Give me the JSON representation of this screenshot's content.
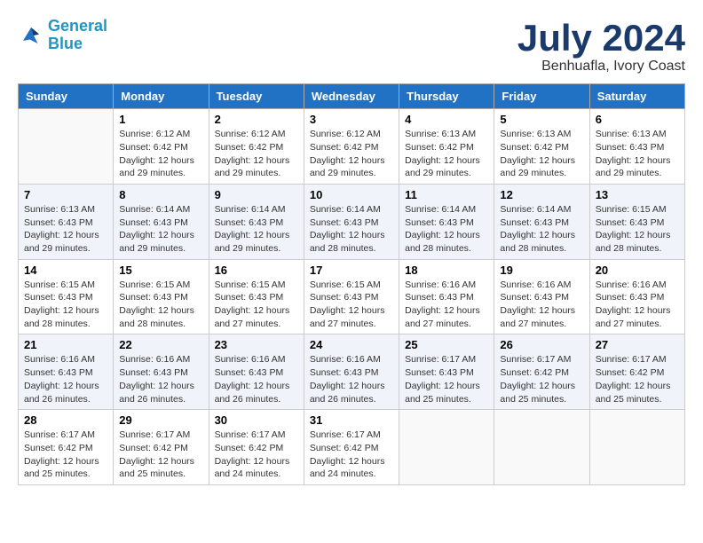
{
  "header": {
    "logo_line1": "General",
    "logo_line2": "Blue",
    "month_year": "July 2024",
    "location": "Benhuafla, Ivory Coast"
  },
  "weekdays": [
    "Sunday",
    "Monday",
    "Tuesday",
    "Wednesday",
    "Thursday",
    "Friday",
    "Saturday"
  ],
  "rows": [
    [
      {
        "day": "",
        "info": ""
      },
      {
        "day": "1",
        "info": "Sunrise: 6:12 AM\nSunset: 6:42 PM\nDaylight: 12 hours\nand 29 minutes."
      },
      {
        "day": "2",
        "info": "Sunrise: 6:12 AM\nSunset: 6:42 PM\nDaylight: 12 hours\nand 29 minutes."
      },
      {
        "day": "3",
        "info": "Sunrise: 6:12 AM\nSunset: 6:42 PM\nDaylight: 12 hours\nand 29 minutes."
      },
      {
        "day": "4",
        "info": "Sunrise: 6:13 AM\nSunset: 6:42 PM\nDaylight: 12 hours\nand 29 minutes."
      },
      {
        "day": "5",
        "info": "Sunrise: 6:13 AM\nSunset: 6:42 PM\nDaylight: 12 hours\nand 29 minutes."
      },
      {
        "day": "6",
        "info": "Sunrise: 6:13 AM\nSunset: 6:43 PM\nDaylight: 12 hours\nand 29 minutes."
      }
    ],
    [
      {
        "day": "7",
        "info": "Sunrise: 6:13 AM\nSunset: 6:43 PM\nDaylight: 12 hours\nand 29 minutes."
      },
      {
        "day": "8",
        "info": "Sunrise: 6:14 AM\nSunset: 6:43 PM\nDaylight: 12 hours\nand 29 minutes."
      },
      {
        "day": "9",
        "info": "Sunrise: 6:14 AM\nSunset: 6:43 PM\nDaylight: 12 hours\nand 29 minutes."
      },
      {
        "day": "10",
        "info": "Sunrise: 6:14 AM\nSunset: 6:43 PM\nDaylight: 12 hours\nand 28 minutes."
      },
      {
        "day": "11",
        "info": "Sunrise: 6:14 AM\nSunset: 6:43 PM\nDaylight: 12 hours\nand 28 minutes."
      },
      {
        "day": "12",
        "info": "Sunrise: 6:14 AM\nSunset: 6:43 PM\nDaylight: 12 hours\nand 28 minutes."
      },
      {
        "day": "13",
        "info": "Sunrise: 6:15 AM\nSunset: 6:43 PM\nDaylight: 12 hours\nand 28 minutes."
      }
    ],
    [
      {
        "day": "14",
        "info": "Sunrise: 6:15 AM\nSunset: 6:43 PM\nDaylight: 12 hours\nand 28 minutes."
      },
      {
        "day": "15",
        "info": "Sunrise: 6:15 AM\nSunset: 6:43 PM\nDaylight: 12 hours\nand 28 minutes."
      },
      {
        "day": "16",
        "info": "Sunrise: 6:15 AM\nSunset: 6:43 PM\nDaylight: 12 hours\nand 27 minutes."
      },
      {
        "day": "17",
        "info": "Sunrise: 6:15 AM\nSunset: 6:43 PM\nDaylight: 12 hours\nand 27 minutes."
      },
      {
        "day": "18",
        "info": "Sunrise: 6:16 AM\nSunset: 6:43 PM\nDaylight: 12 hours\nand 27 minutes."
      },
      {
        "day": "19",
        "info": "Sunrise: 6:16 AM\nSunset: 6:43 PM\nDaylight: 12 hours\nand 27 minutes."
      },
      {
        "day": "20",
        "info": "Sunrise: 6:16 AM\nSunset: 6:43 PM\nDaylight: 12 hours\nand 27 minutes."
      }
    ],
    [
      {
        "day": "21",
        "info": "Sunrise: 6:16 AM\nSunset: 6:43 PM\nDaylight: 12 hours\nand 26 minutes."
      },
      {
        "day": "22",
        "info": "Sunrise: 6:16 AM\nSunset: 6:43 PM\nDaylight: 12 hours\nand 26 minutes."
      },
      {
        "day": "23",
        "info": "Sunrise: 6:16 AM\nSunset: 6:43 PM\nDaylight: 12 hours\nand 26 minutes."
      },
      {
        "day": "24",
        "info": "Sunrise: 6:16 AM\nSunset: 6:43 PM\nDaylight: 12 hours\nand 26 minutes."
      },
      {
        "day": "25",
        "info": "Sunrise: 6:17 AM\nSunset: 6:43 PM\nDaylight: 12 hours\nand 25 minutes."
      },
      {
        "day": "26",
        "info": "Sunrise: 6:17 AM\nSunset: 6:42 PM\nDaylight: 12 hours\nand 25 minutes."
      },
      {
        "day": "27",
        "info": "Sunrise: 6:17 AM\nSunset: 6:42 PM\nDaylight: 12 hours\nand 25 minutes."
      }
    ],
    [
      {
        "day": "28",
        "info": "Sunrise: 6:17 AM\nSunset: 6:42 PM\nDaylight: 12 hours\nand 25 minutes."
      },
      {
        "day": "29",
        "info": "Sunrise: 6:17 AM\nSunset: 6:42 PM\nDaylight: 12 hours\nand 25 minutes."
      },
      {
        "day": "30",
        "info": "Sunrise: 6:17 AM\nSunset: 6:42 PM\nDaylight: 12 hours\nand 24 minutes."
      },
      {
        "day": "31",
        "info": "Sunrise: 6:17 AM\nSunset: 6:42 PM\nDaylight: 12 hours\nand 24 minutes."
      },
      {
        "day": "",
        "info": ""
      },
      {
        "day": "",
        "info": ""
      },
      {
        "day": "",
        "info": ""
      }
    ]
  ]
}
